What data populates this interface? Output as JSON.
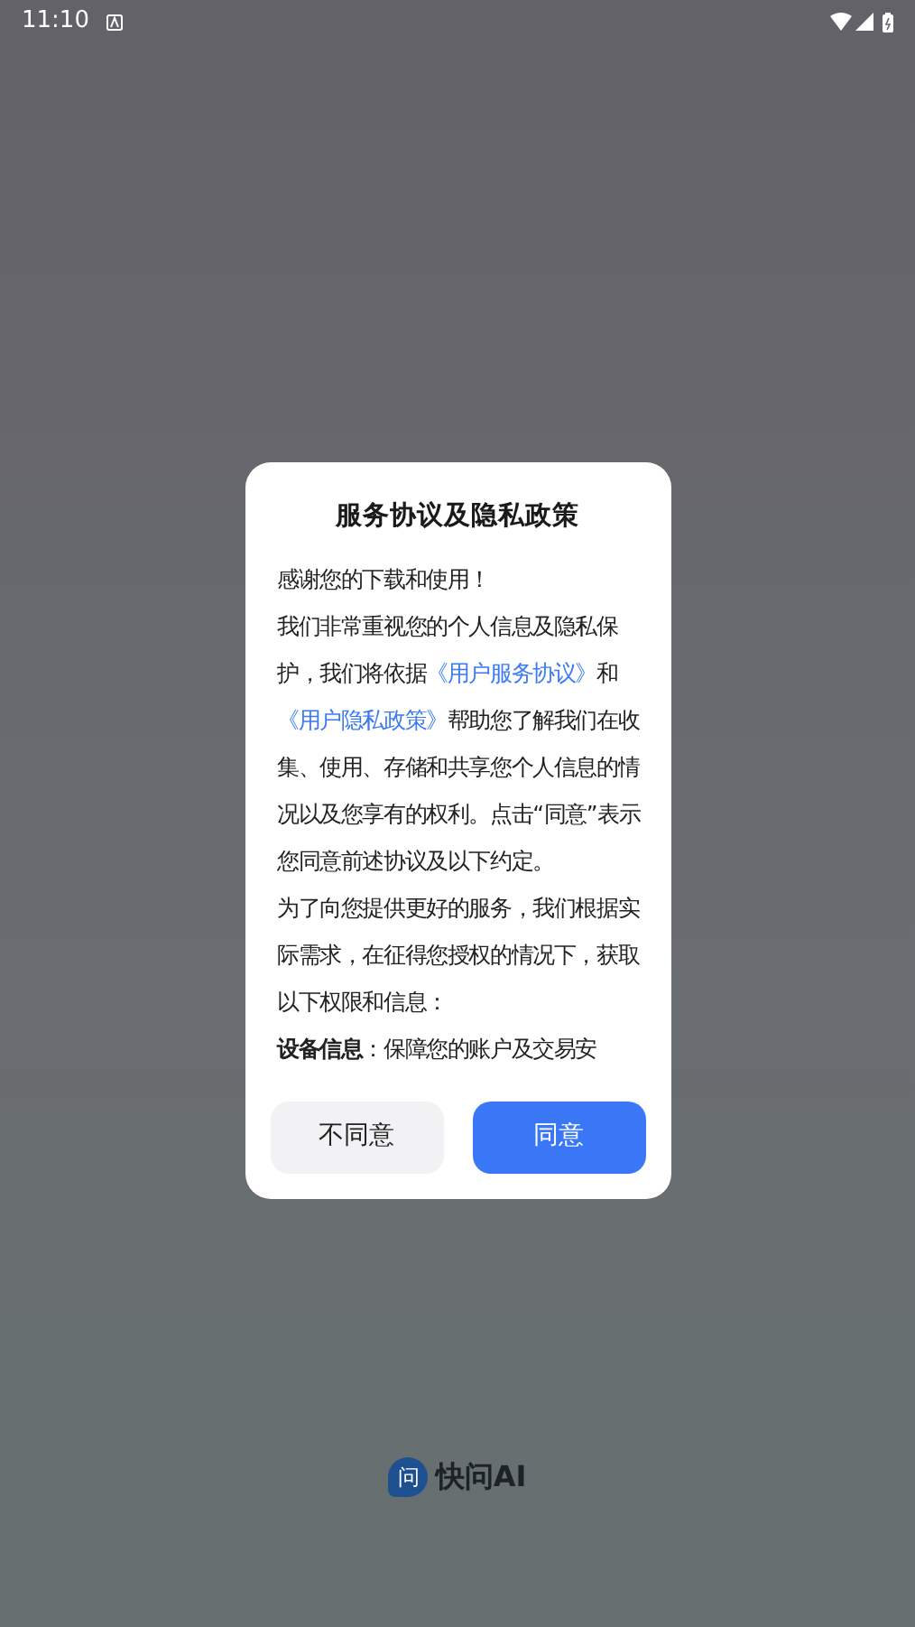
{
  "status_bar": {
    "time": "11:10"
  },
  "dialog": {
    "title": "服务协议及隐私政策",
    "paragraphs": [
      [
        {
          "kind": "text",
          "text": "感谢您的下载和使用！"
        }
      ],
      [
        {
          "kind": "text",
          "text": "我们非常重视您的个人信息及隐私保护，我们将依据"
        },
        {
          "kind": "link",
          "text": "《用户服务协议》"
        },
        {
          "kind": "text",
          "text": "和"
        },
        {
          "kind": "link",
          "text": "《用户隐私政策》"
        },
        {
          "kind": "text",
          "text": "帮助您了解我们在收集、使用、存储和共享您个人信息的情况以及您享有的权利。点击“同意”表示您同意前述协议及以下约定。"
        }
      ],
      [
        {
          "kind": "text",
          "text": "为了向您提供更好的服务，我们根据实际需求，在征得您授权的情况下，获取以下权限和信息："
        }
      ],
      [
        {
          "kind": "text",
          "text": "**设备信息**：保障您的账户及交易安"
        }
      ]
    ],
    "buttons": [
      {
        "label": "不同意",
        "kind": "secondary"
      },
      {
        "label": "同意",
        "kind": "primary"
      }
    ]
  },
  "logo": {
    "mark": "问",
    "name": "快问AI"
  }
}
